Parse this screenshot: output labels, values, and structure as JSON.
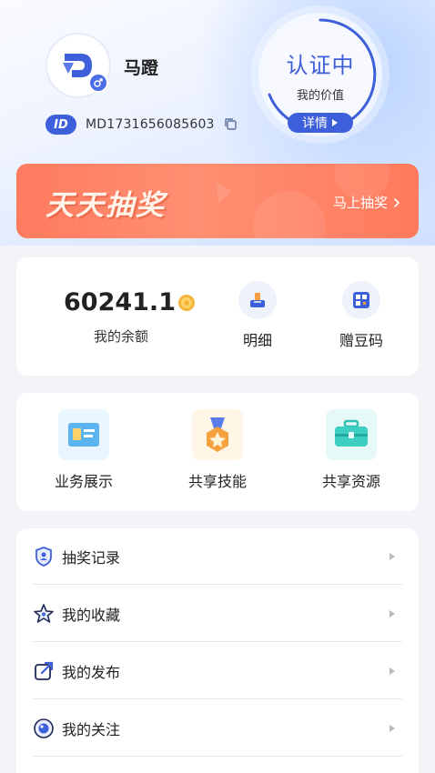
{
  "profile": {
    "username": "马蹬",
    "id_badge": "ID",
    "id_value": "MD1731656085603"
  },
  "verification": {
    "status": "认证中",
    "subtitle": "我的价值",
    "detail_label": "详情"
  },
  "banner": {
    "title": "天天抽奖",
    "cta": "马上抽奖"
  },
  "wallet": {
    "balance": "60241.1",
    "balance_label": "我的余额",
    "actions": [
      {
        "label": "明细",
        "icon": "inbox-tray-icon"
      },
      {
        "label": "赠豆码",
        "icon": "qr-code-icon"
      }
    ]
  },
  "services": [
    {
      "label": "业务展示",
      "icon": "business-card-icon"
    },
    {
      "label": "共享技能",
      "icon": "skill-medal-icon"
    },
    {
      "label": "共享资源",
      "icon": "toolbox-icon"
    }
  ],
  "menu": [
    {
      "label": "抽奖记录",
      "icon": "shield-user-icon"
    },
    {
      "label": "我的收藏",
      "icon": "star-icon"
    },
    {
      "label": "我的发布",
      "icon": "publish-icon"
    },
    {
      "label": "我的关注",
      "icon": "eye-icon"
    }
  ],
  "colors": {
    "primary": "#3d5fd9",
    "banner": "#ff7b5f",
    "background": "#f3f4f8"
  }
}
